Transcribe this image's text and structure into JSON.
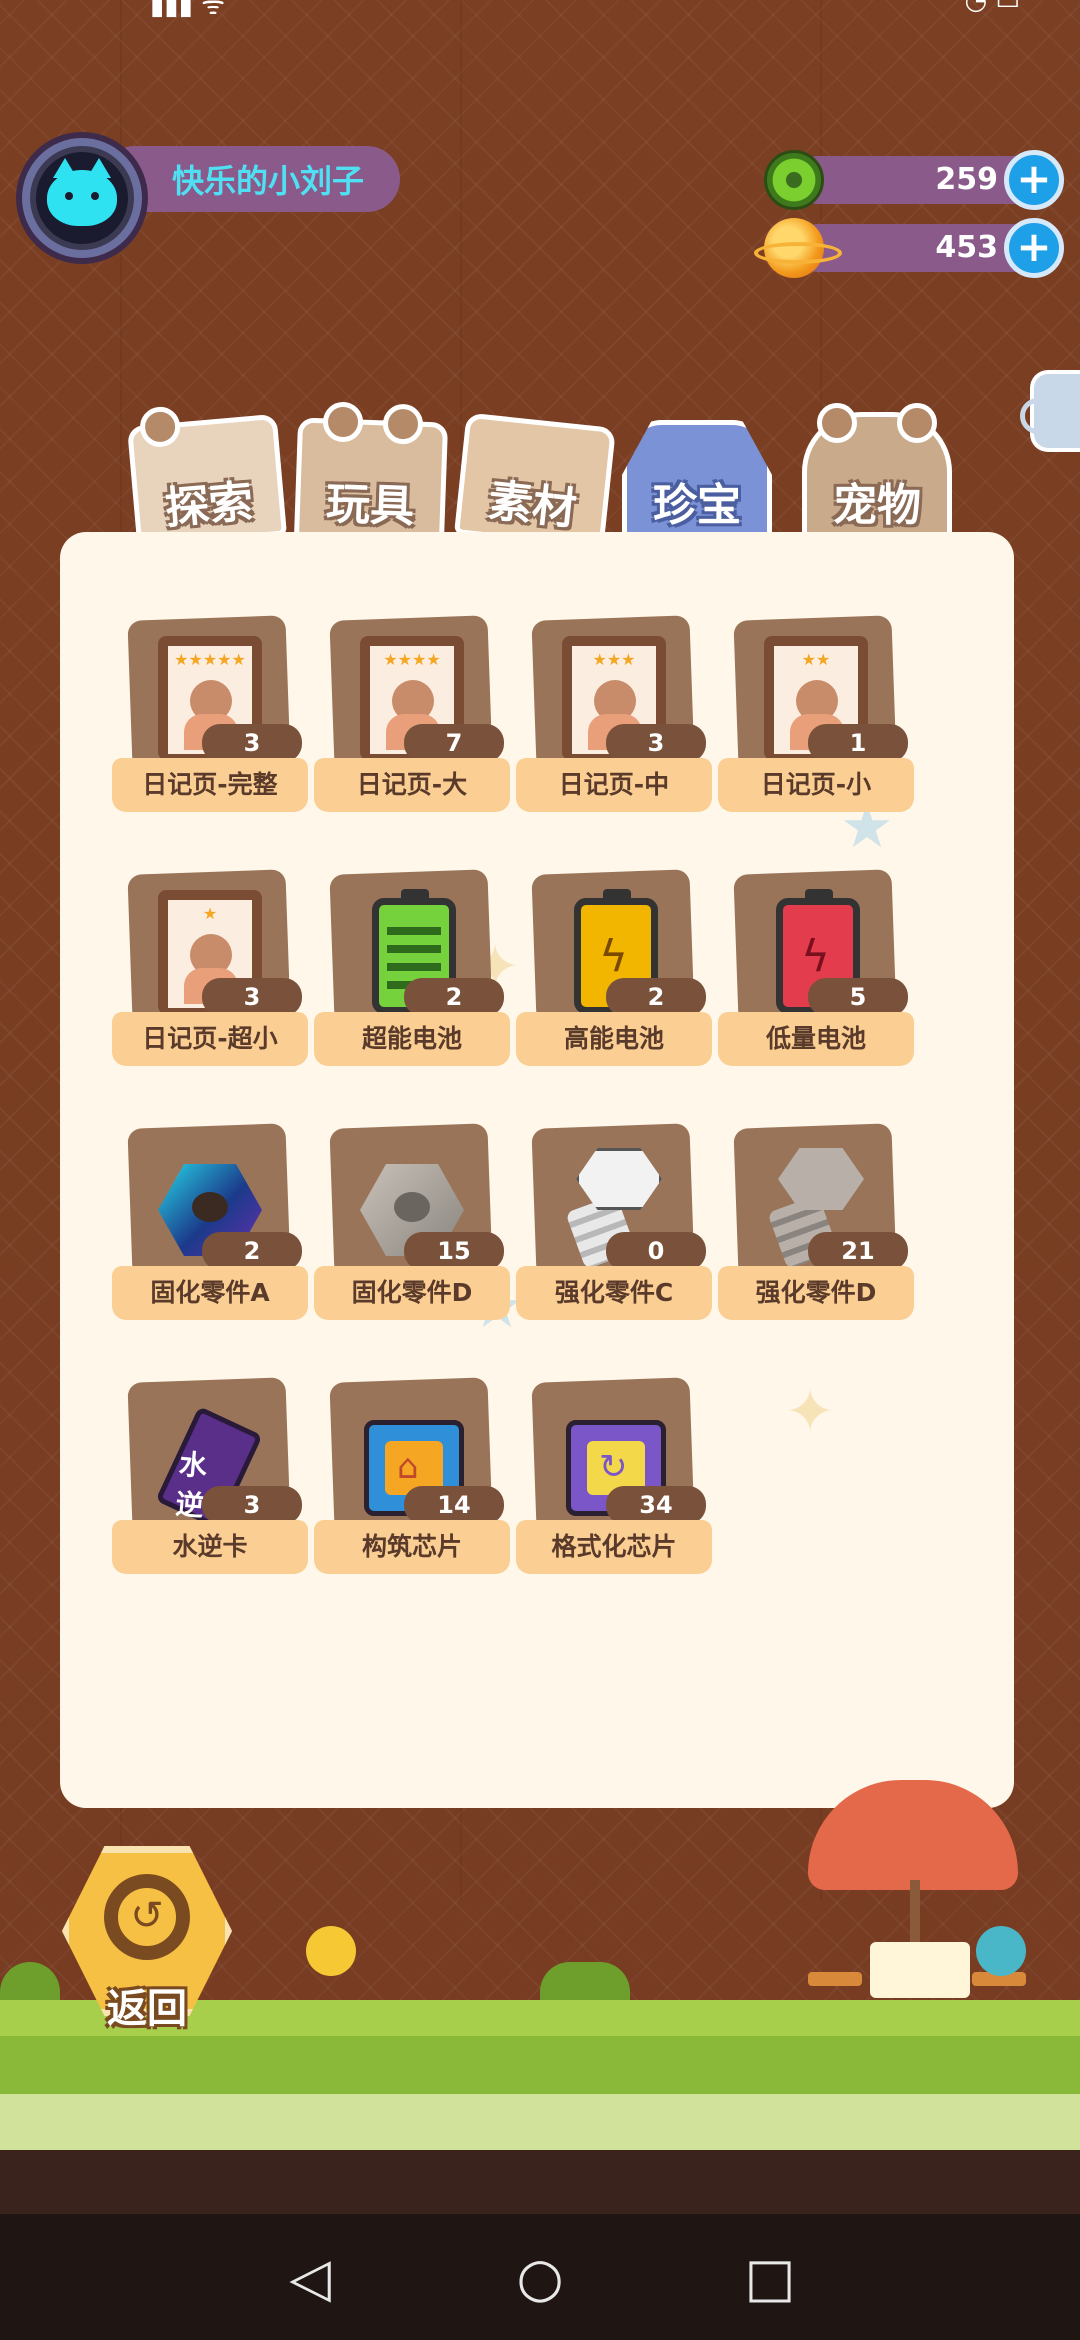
{
  "user": {
    "name": "快乐的小刘子"
  },
  "currency": [
    {
      "icon": "donut-coin-icon",
      "value": "259"
    },
    {
      "icon": "planet-coin-icon",
      "value": "453"
    }
  ],
  "tabs": [
    "探索",
    "玩具",
    "素材",
    "珍宝",
    "宠物"
  ],
  "items": [
    {
      "name": "日记页-完整",
      "count": "3",
      "icon": "diary-page-icon",
      "stars": "★★★★★"
    },
    {
      "name": "日记页-大",
      "count": "7",
      "icon": "diary-page-icon",
      "stars": "★★★★"
    },
    {
      "name": "日记页-中",
      "count": "3",
      "icon": "diary-page-icon",
      "stars": "★★★"
    },
    {
      "name": "日记页-小",
      "count": "1",
      "icon": "diary-page-icon",
      "stars": "★★"
    },
    {
      "name": "日记页-超小",
      "count": "3",
      "icon": "diary-page-icon",
      "stars": "★"
    },
    {
      "name": "超能电池",
      "count": "2",
      "icon": "green-battery-icon"
    },
    {
      "name": "高能电池",
      "count": "2",
      "icon": "yellow-battery-icon"
    },
    {
      "name": "低量电池",
      "count": "5",
      "icon": "red-battery-icon"
    },
    {
      "name": "固化零件A",
      "count": "2",
      "icon": "hex-nut-icon"
    },
    {
      "name": "固化零件D",
      "count": "15",
      "icon": "hex-nut-icon"
    },
    {
      "name": "强化零件C",
      "count": "0",
      "icon": "bolt-icon"
    },
    {
      "name": "强化零件D",
      "count": "21",
      "icon": "bolt-icon"
    },
    {
      "name": "水逆卡",
      "count": "3",
      "icon": "card-icon",
      "card_text": "水逆"
    },
    {
      "name": "构筑芯片",
      "count": "14",
      "icon": "chip-icon"
    },
    {
      "name": "格式化芯片",
      "count": "34",
      "icon": "chip-icon"
    }
  ],
  "back": {
    "label": "返回"
  },
  "nav": {
    "back": "◁",
    "home": "○",
    "recents": "□"
  }
}
